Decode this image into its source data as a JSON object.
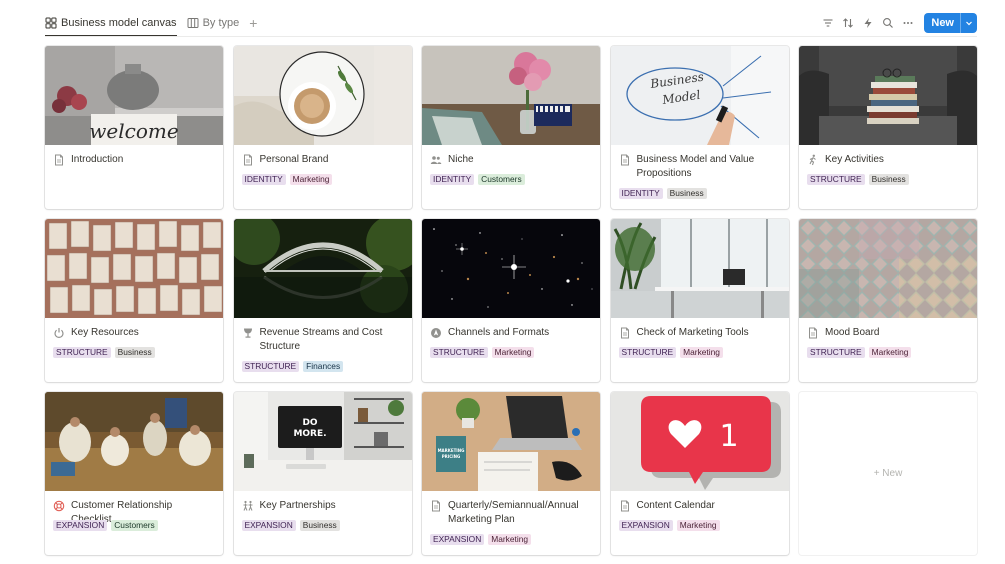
{
  "toolbar": {
    "tabs": [
      {
        "label": "Business model canvas",
        "icon": "gallery-icon",
        "active": true
      },
      {
        "label": "By type",
        "icon": "board-icon",
        "active": false
      }
    ],
    "add_tab": "+",
    "tools": [
      "filter-icon",
      "sort-icon",
      "automation-icon",
      "search-icon",
      "more-icon"
    ],
    "new_label": "New"
  },
  "colors": {
    "accent": "#2383e2",
    "purple_tag": "#e8deee",
    "pink_tag": "#f4dfeb",
    "green_tag": "#dbeddb",
    "gray_tag": "#e3e2e0",
    "blue_tag": "#d3e5ef"
  },
  "cards": [
    {
      "title": "Introduction",
      "icon": "page-icon",
      "tags": []
    },
    {
      "title": "Personal Brand",
      "icon": "page-icon",
      "tags": [
        {
          "label": "IDENTITY",
          "color": "identity"
        },
        {
          "label": "Marketing",
          "color": "marketing"
        }
      ]
    },
    {
      "title": "Niche",
      "icon": "people-icon",
      "tags": [
        {
          "label": "IDENTITY",
          "color": "identity"
        },
        {
          "label": "Customers",
          "color": "customers"
        }
      ]
    },
    {
      "title": "Business Model and Value Propositions",
      "icon": "page-icon",
      "tags": [
        {
          "label": "IDENTITY",
          "color": "identity"
        },
        {
          "label": "Business",
          "color": "business"
        }
      ]
    },
    {
      "title": "Key Activities",
      "icon": "runner-icon",
      "tags": [
        {
          "label": "STRUCTURE",
          "color": "structure"
        },
        {
          "label": "Business",
          "color": "business"
        }
      ]
    },
    {
      "title": "Key Resources",
      "icon": "power-icon",
      "tags": [
        {
          "label": "STRUCTURE",
          "color": "structure"
        },
        {
          "label": "Business",
          "color": "business"
        }
      ]
    },
    {
      "title": "Revenue Streams and Cost Structure",
      "icon": "trophy-icon",
      "tags": [
        {
          "label": "STRUCTURE",
          "color": "structure"
        },
        {
          "label": "Finances",
          "color": "finances"
        }
      ]
    },
    {
      "title": "Channels and Formats",
      "icon": "compass-icon",
      "tags": [
        {
          "label": "STRUCTURE",
          "color": "structure"
        },
        {
          "label": "Marketing",
          "color": "marketing"
        }
      ]
    },
    {
      "title": "Check of Marketing Tools",
      "icon": "page-icon",
      "tags": [
        {
          "label": "STRUCTURE",
          "color": "structure"
        },
        {
          "label": "Marketing",
          "color": "marketing"
        }
      ]
    },
    {
      "title": "Mood Board",
      "icon": "page-icon",
      "tags": [
        {
          "label": "STRUCTURE",
          "color": "structure"
        },
        {
          "label": "Marketing",
          "color": "marketing"
        }
      ]
    },
    {
      "title": "Customer Relationship Checklist",
      "icon": "lifebuoy-icon",
      "tags": [
        {
          "label": "EXPANSION",
          "color": "expansion"
        },
        {
          "label": "Customers",
          "color": "customers"
        }
      ]
    },
    {
      "title": "Key Partnerships",
      "icon": "partners-icon",
      "tags": [
        {
          "label": "EXPANSION",
          "color": "expansion"
        },
        {
          "label": "Business",
          "color": "business"
        }
      ]
    },
    {
      "title": "Quarterly/Semiannual/Annual Marketing Plan",
      "icon": "page-icon",
      "tags": [
        {
          "label": "EXPANSION",
          "color": "expansion"
        },
        {
          "label": "Marketing",
          "color": "marketing"
        }
      ]
    },
    {
      "title": "Content Calendar",
      "icon": "page-icon",
      "tags": [
        {
          "label": "EXPANSION",
          "color": "expansion"
        },
        {
          "label": "Marketing",
          "color": "marketing"
        }
      ]
    }
  ],
  "covers": {
    "c0": {
      "text": "welcome"
    },
    "c3": {
      "line1": "Business",
      "line2": "Model"
    },
    "c11": {
      "line1": "DO",
      "line2": "MORE."
    },
    "c12": {
      "line1": "MARKETING",
      "line2": "PRICING"
    },
    "c13": {
      "text": "1"
    }
  },
  "new_card_label": "+ New"
}
